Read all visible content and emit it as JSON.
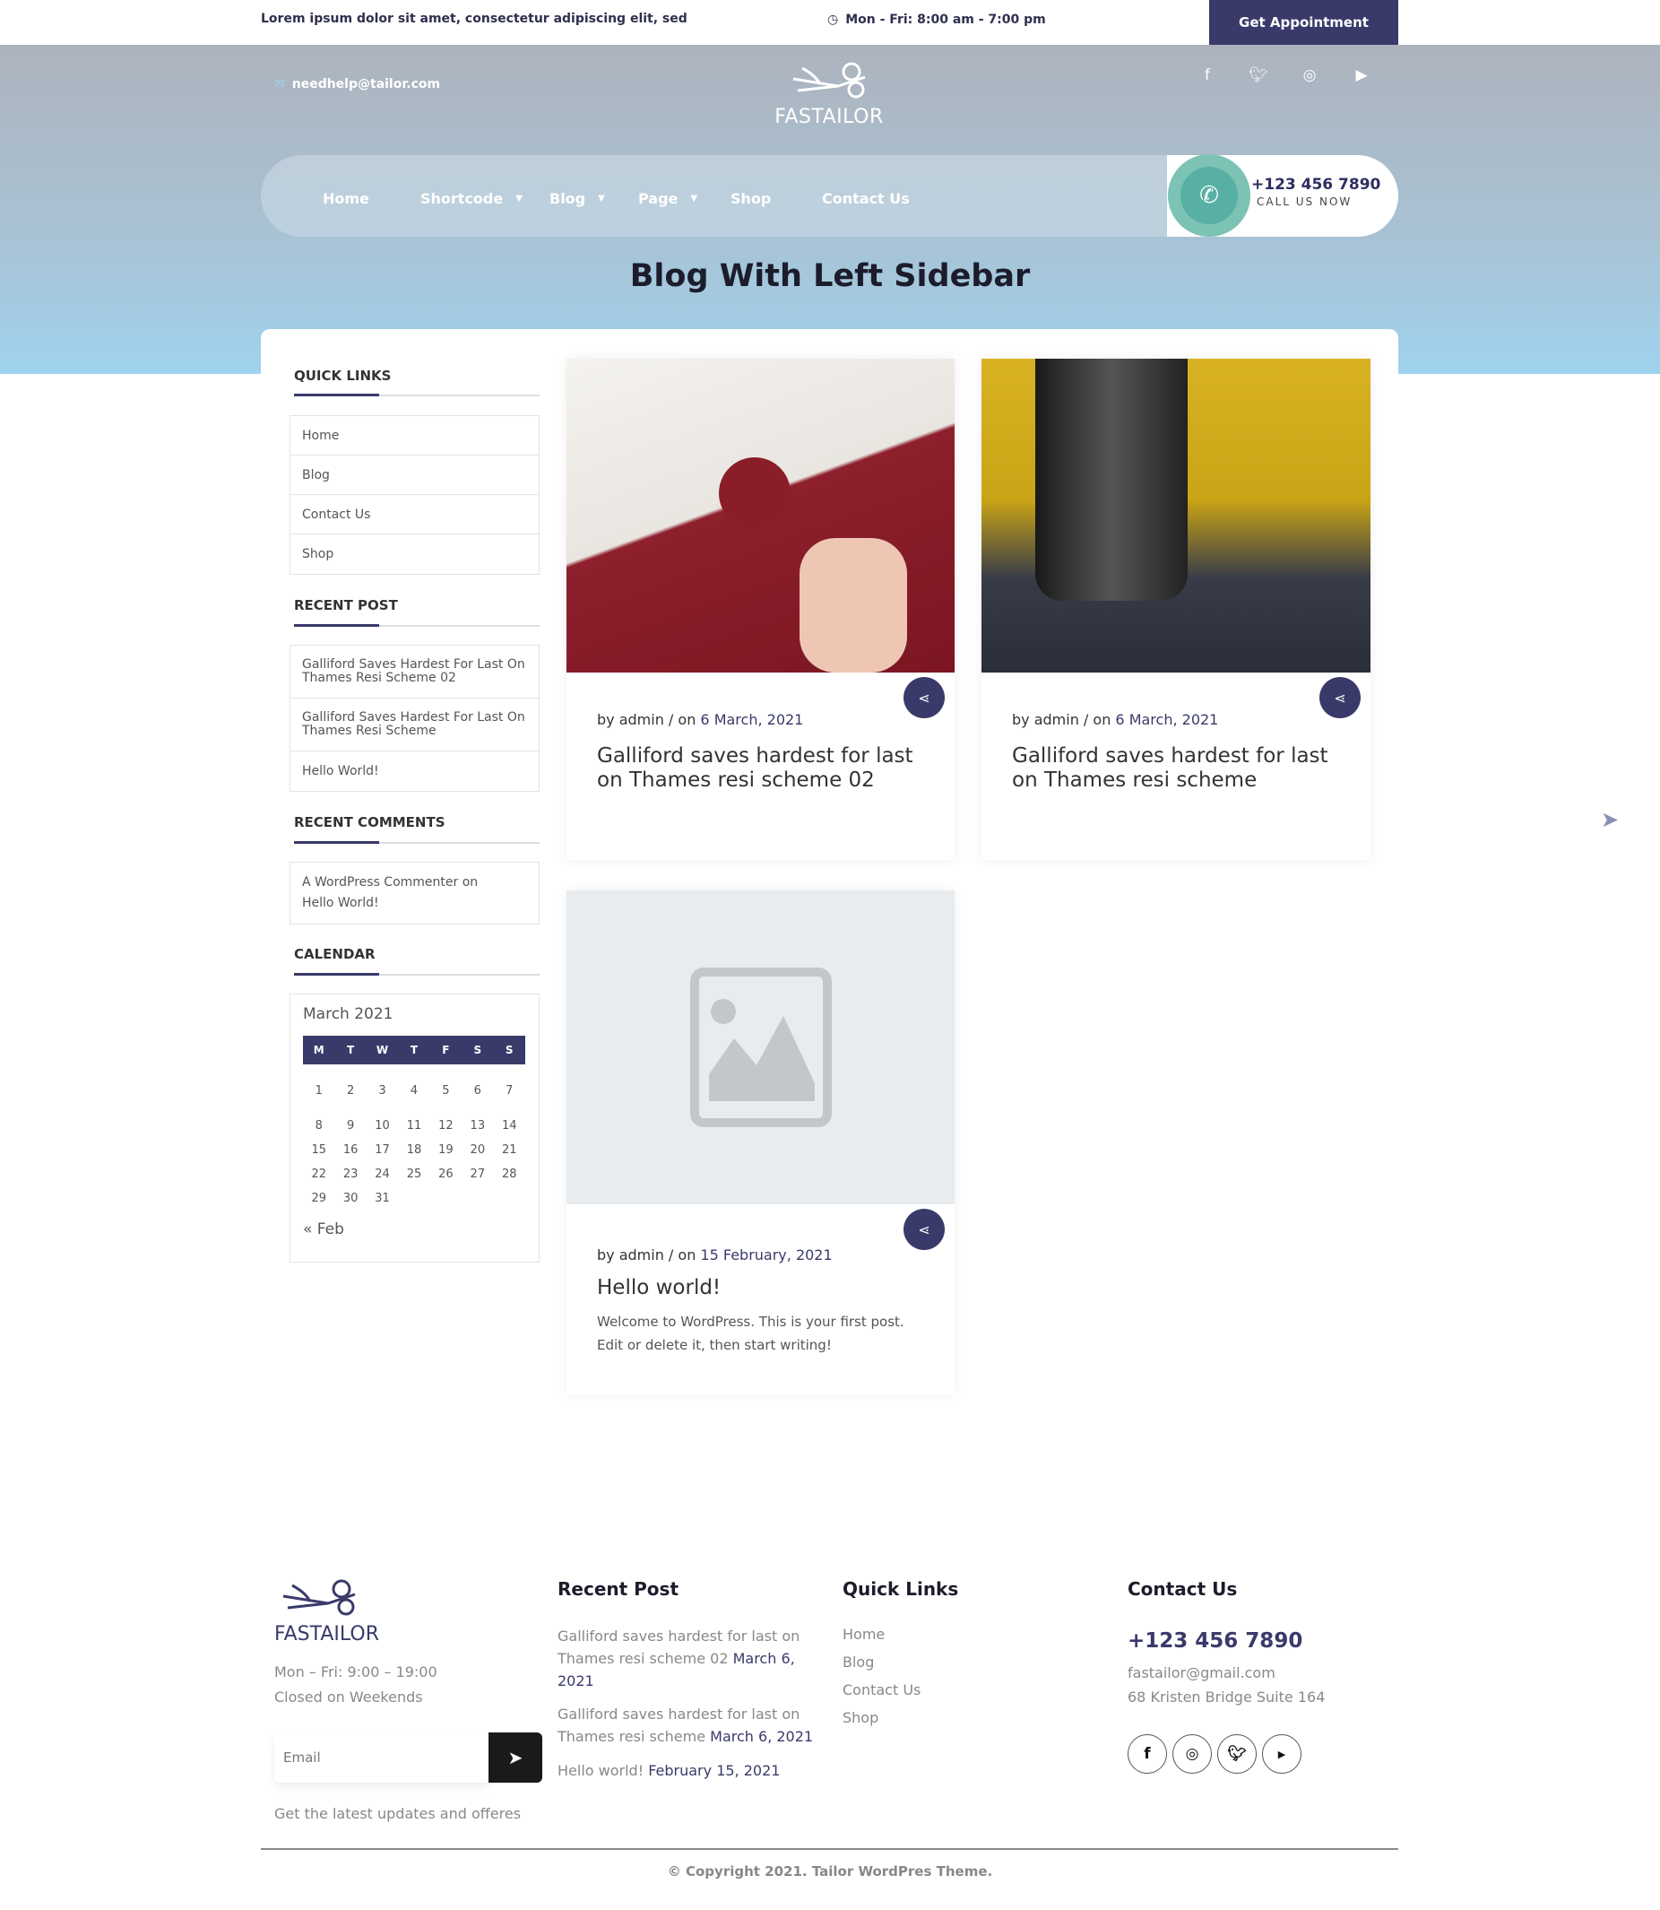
{
  "topbar": {
    "tagline": "Lorem ipsum dolor sit amet, consectetur adipiscing elit, sed",
    "hours": "Mon - Fri: 8:00 am - 7:00 pm",
    "appointment": "Get Appointment"
  },
  "header": {
    "email": "needhelp@tailor.com",
    "logo": "FASTAILOR",
    "social": [
      "facebook-icon",
      "twitter-icon",
      "instagram-icon",
      "youtube-icon"
    ]
  },
  "nav": {
    "items": [
      {
        "label": "Home"
      },
      {
        "label": "Shortcode",
        "dropdown": true
      },
      {
        "label": "Blog",
        "dropdown": true
      },
      {
        "label": "Page",
        "dropdown": true
      },
      {
        "label": "Shop"
      },
      {
        "label": "Contact Us"
      }
    ],
    "phone": "+123 456 7890",
    "call_label": "CALL US NOW"
  },
  "page_title": "Blog With Left Sidebar",
  "sidebar": {
    "quick_links": {
      "title": "QUICK LINKS",
      "items": [
        "Home",
        "Blog",
        "Contact Us",
        "Shop"
      ]
    },
    "recent_post": {
      "title": "RECENT POST",
      "items": [
        "Galliford Saves Hardest For Last On Thames Resi Scheme 02",
        "Galliford Saves Hardest For Last On Thames Resi Scheme",
        "Hello World!"
      ]
    },
    "recent_comments": {
      "title": "RECENT COMMENTS",
      "items": [
        "A WordPress Commenter on Hello World!"
      ]
    },
    "calendar": {
      "title": "CALENDAR",
      "month": "March 2021",
      "days": [
        "M",
        "T",
        "W",
        "T",
        "F",
        "S",
        "S"
      ],
      "weeks": [
        [
          "1",
          "2",
          "3",
          "4",
          "5",
          "6",
          "7"
        ],
        [
          "8",
          "9",
          "10",
          "11",
          "12",
          "13",
          "14"
        ],
        [
          "15",
          "16",
          "17",
          "18",
          "19",
          "20",
          "21"
        ],
        [
          "22",
          "23",
          "24",
          "25",
          "26",
          "27",
          "28"
        ],
        [
          "29",
          "30",
          "31",
          "",
          "",
          "",
          ""
        ]
      ],
      "prev": "« Feb"
    }
  },
  "posts": [
    {
      "by": "by admin / on ",
      "date": "6 March, 2021",
      "title": "Galliford saves hardest for last on Thames resi scheme 02",
      "excerpt": ""
    },
    {
      "by": "by admin / on ",
      "date": "6 March, 2021",
      "title": "Galliford saves hardest for last on Thames resi scheme",
      "excerpt": ""
    },
    {
      "by": "by admin / on ",
      "date": "15 February, 2021",
      "title": "Hello world!",
      "excerpt": "Welcome to WordPress. This is your first post. Edit or delete it, then start writing!"
    }
  ],
  "footer": {
    "logo": "FASTAILOR",
    "hours": "Mon – Fri: 9:00 – 19:00",
    "closed": "Closed on Weekends",
    "email_placeholder": "Email",
    "newsletter_note": "Get the latest updates and offeres",
    "recent_post": {
      "title": "Recent Post",
      "items": [
        {
          "text": "Galliford saves hardest for last on Thames resi scheme 02",
          "date": "March 6, 2021"
        },
        {
          "text": "Galliford saves hardest for last on Thames resi scheme",
          "date": "March 6, 2021"
        },
        {
          "text": "Hello world!",
          "date": "February 15, 2021"
        }
      ]
    },
    "quick_links": {
      "title": "Quick Links",
      "items": [
        "Home",
        "Blog",
        "Contact Us",
        "Shop"
      ]
    },
    "contact": {
      "title": "Contact Us",
      "phone": "+123 456 7890",
      "email": "fastailor@gmail.com",
      "address": "68 Kristen Bridge Suite 164"
    },
    "copyright": "© Copyright 2021. Tailor WordPres Theme."
  },
  "colors": {
    "accent": "#393a6a",
    "teal": "#57b0a3"
  }
}
